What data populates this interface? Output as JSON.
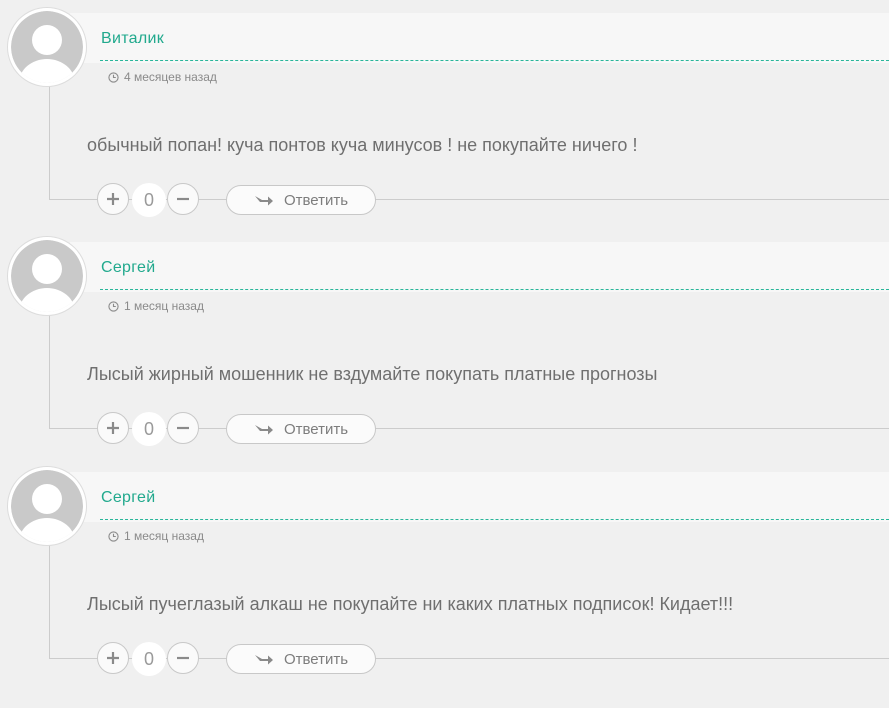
{
  "comments": [
    {
      "author": "Виталик",
      "date": "4 месяцев назад",
      "text": "обычный попан! куча понтов куча минусов ! не покупайте ничего !",
      "votes": "0",
      "reply_label": "Ответить"
    },
    {
      "author": "Сергей",
      "date": "1 месяц назад",
      "text": "Лысый жирный мошенник не вздумайте покупать платные прогнозы",
      "votes": "0",
      "reply_label": "Ответить"
    },
    {
      "author": "Сергей",
      "date": "1 месяц назад",
      "text": "Лысый пучеглазый алкаш не покупайте ни каких платных подписок! Кидает!!!",
      "votes": "0",
      "reply_label": "Ответить"
    }
  ],
  "icons": {
    "avatar": "user-avatar-placeholder-icon",
    "date": "clock-icon",
    "upvote": "plus-icon",
    "downvote": "minus-icon",
    "reply": "reply-arrow-icon"
  },
  "colors": {
    "author": "#21a98d",
    "dashed_divider": "#29b69a",
    "comment_text": "#6f6f6f",
    "background": "#f0f0f0"
  }
}
